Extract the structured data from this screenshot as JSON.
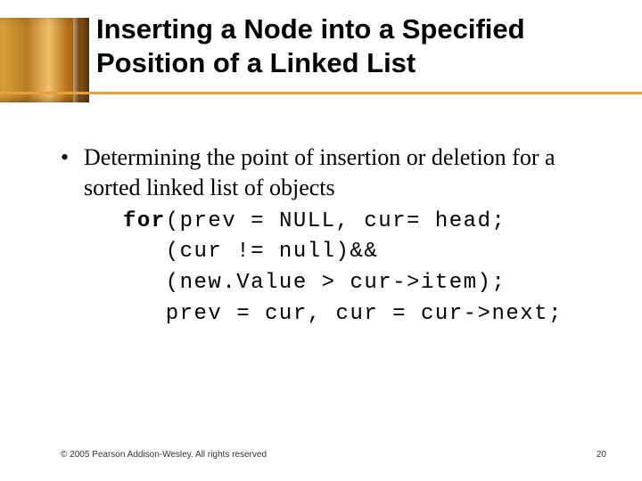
{
  "header": {
    "title": "Inserting a Node into a Specified Position of a Linked List"
  },
  "content": {
    "bullet1": "Determining the point of insertion or deletion for a sorted linked list of objects",
    "code": {
      "kw_for": "for",
      "line1_rest": "(prev = NULL, cur= head;",
      "line2": "   (cur != null)&&",
      "line3": "   (new.Value > cur->item);",
      "line4": "   prev = cur, cur = cur->next;"
    }
  },
  "footer": {
    "copyright": "© 2005 Pearson Addison-Wesley. All rights reserved",
    "page": "20"
  }
}
